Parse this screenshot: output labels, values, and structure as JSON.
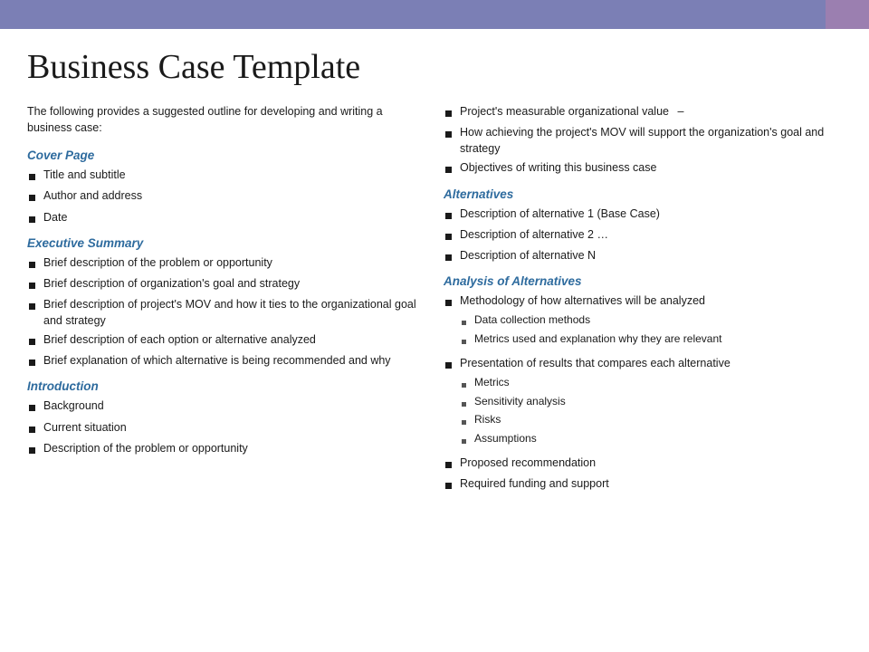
{
  "header": {
    "title": "Business Case Template",
    "banner_left_color": "#7b7fb5",
    "banner_right_color": "#9b7fb0"
  },
  "intro": "The following provides a suggested outline for developing and writing a business case:",
  "left_column": {
    "sections": [
      {
        "heading": "Cover Page",
        "items": [
          "Title and subtitle",
          "Author and address",
          "Date"
        ]
      },
      {
        "heading": "Executive Summary",
        "items": [
          "Brief description of the problem or opportunity",
          "Brief description of organization's goal and strategy",
          "Brief description of project's MOV and how it ties to the organizational goal and strategy",
          "Brief description of each option or alternative analyzed",
          "Brief explanation of which alternative is being recommended and why"
        ]
      },
      {
        "heading": "Introduction",
        "items": [
          "Background",
          "Current situation",
          "Description of the problem or opportunity"
        ]
      }
    ]
  },
  "right_column": {
    "intro_items": [
      {
        "text": "Project's measurable organizational value",
        "suffix": " –"
      },
      {
        "text": "How achieving the project's MOV will support the organization's goal and strategy",
        "suffix": ""
      },
      {
        "text": "Objectives of writing this business case",
        "suffix": ""
      }
    ],
    "sections": [
      {
        "heading": "Alternatives",
        "items": [
          {
            "text": "Description of alternative 1 (Base Case)",
            "sub": []
          },
          {
            "text": "Description of alternative 2 …",
            "sub": []
          },
          {
            "text": "Description of alternative N",
            "sub": []
          }
        ]
      },
      {
        "heading": "Analysis of Alternatives",
        "items": [
          {
            "text": "Methodology of how alternatives will be analyzed",
            "sub": [
              "Data collection methods",
              "Metrics used and explanation why they are relevant"
            ]
          },
          {
            "text": "Presentation of results that compares each alternative",
            "sub": [
              "Metrics",
              "Sensitivity analysis",
              "Risks",
              "Assumptions"
            ]
          },
          {
            "text": "Proposed recommendation",
            "sub": []
          },
          {
            "text": "Required funding and support",
            "sub": []
          }
        ]
      }
    ]
  }
}
